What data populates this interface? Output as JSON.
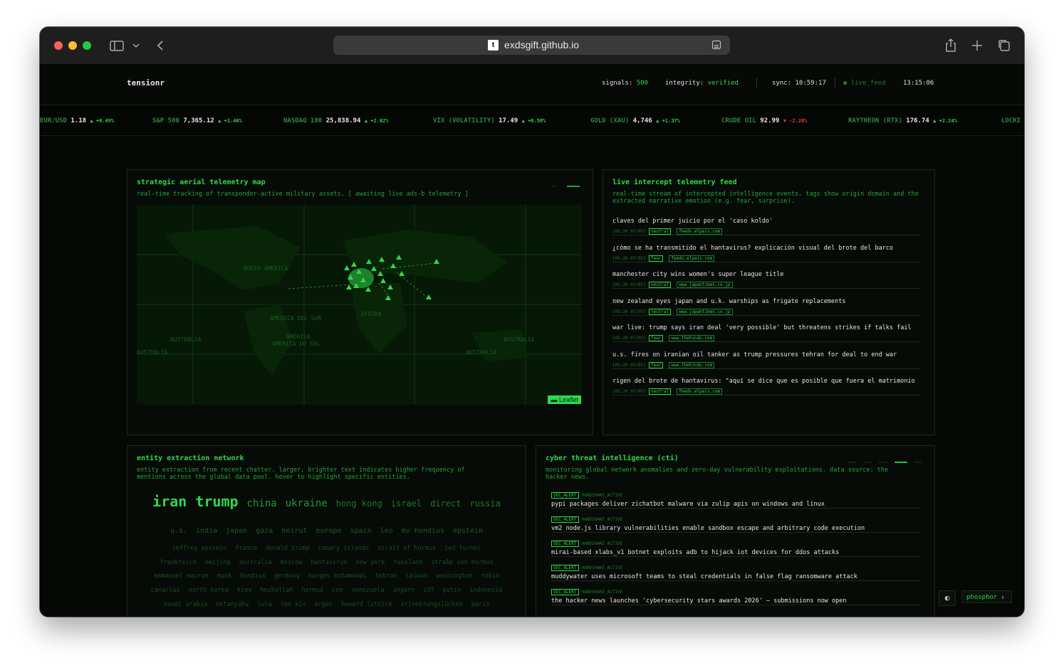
{
  "browser": {
    "url": "exdsgift.github.io",
    "favicon": "t"
  },
  "header": {
    "brand": "tensionr",
    "signals_label": "signals:",
    "signals_value": "500",
    "integrity_label": "integrity:",
    "integrity_value": "verified",
    "sync": "sync: 10:59:17",
    "live_feed": "live_feed",
    "clock": "13:15:06"
  },
  "ticker": [
    {
      "name": "EUR/USD",
      "price": "1.18",
      "change": "+0.49%",
      "dir": "up"
    },
    {
      "name": "S&P 500",
      "price": "7,365.12",
      "change": "+1.46%",
      "dir": "up"
    },
    {
      "name": "NASDAQ 100",
      "price": "25,838.94",
      "change": "+2.02%",
      "dir": "up"
    },
    {
      "name": "VIX (VOLATILITY)",
      "price": "17.49",
      "change": "+0.58%",
      "dir": "up"
    },
    {
      "name": "GOLD (XAU)",
      "price": "4,746",
      "change": "+1.37%",
      "dir": "up"
    },
    {
      "name": "CRUDE OIL",
      "price": "92.99",
      "change": "-2.20%",
      "dir": "down"
    },
    {
      "name": "RAYTHEON (RTX)",
      "price": "176.74",
      "change": "+2.24%",
      "dir": "up"
    },
    {
      "name": "LOCKI",
      "price": "",
      "change": "",
      "dir": "up"
    }
  ],
  "map_panel": {
    "title": "strategic aerial telemetry map",
    "desc": "real-time tracking of transponder-active military assets. [ awaiting live ads-b telemetry ]",
    "labels": [
      "NORTH AMERICA",
      "AFRIKA",
      "AMÉRICA",
      "AMERICA DO SUL",
      "AMÉRICA DEL SUR",
      "AUSTRALIA",
      "AUSTRALIA",
      "AUSTRALIA",
      "AUSTRALIA"
    ],
    "leaflet": "Leaflet"
  },
  "feed_panel": {
    "title": "live intercept telemetry feed",
    "desc": "real-time stream of intercepted intelligence events. tags show origin domain and the extracted narrative emotion (e.g. fear, surprise).",
    "items": [
      {
        "title": "claves del primer juicio por el 'caso koldo'",
        "time": "[05:20 07/05]",
        "emotion": "neutral",
        "domain": "feeds.elpais.com"
      },
      {
        "title": "¿cómo se ha transmitido el hantavirus? explicación visual del brote del barco",
        "time": "[05:20 07/05]",
        "emotion": "fear",
        "domain": "feeds.elpais.com"
      },
      {
        "title": "manchester city wins women's super league title",
        "time": "[05:20 07/05]",
        "emotion": "neutral",
        "domain": "www.japantimes.co.jp"
      },
      {
        "title": "new zealand eyes japan and u.k. warships as frigate replacements",
        "time": "[05:20 07/05]",
        "emotion": "neutral",
        "domain": "www.japantimes.co.jp"
      },
      {
        "title": " war live: trump says iran deal 'very possible' but threatens strikes if talks fail",
        "time": "[05:20 07/05]",
        "emotion": "fear",
        "domain": "www.thehindu.com"
      },
      {
        "title": "u.s. fires on iranian oil tanker as trump pressures tehran for deal to end war",
        "time": "[05:20 07/05]",
        "emotion": "fear",
        "domain": "www.thehindu.com"
      },
      {
        "title": "rigen del brote de hantavirus: \"aquí se dice que es posible que fuera el matrimonio",
        "time": "[05:20 07/05]",
        "emotion": "neutral",
        "domain": "feeds.elpais.com"
      }
    ]
  },
  "entity_panel": {
    "title": "entity extraction network",
    "desc": "entity extraction from recent chatter. larger, brighter text indicates higher frequency of mentions across the global data pool. hover to highlight specific entities.",
    "rows": [
      [
        "iran",
        "trump",
        "china",
        "ukraine",
        "hong kong",
        "israel",
        "direct",
        "russia"
      ],
      [
        "u.s.",
        "india",
        "japan",
        "gaza",
        "beirut",
        "europe",
        "spain",
        "leo",
        "mv hondius",
        "epstein"
      ],
      [
        "jeffrey epstein",
        "france",
        "donald trump",
        "canary islands",
        "strait of hormuz",
        "ted turner"
      ],
      [
        "frankreich",
        "beijing",
        "australia",
        "moscow",
        "hantavirus",
        "new york",
        "russland",
        "straße von hormus"
      ],
      [
        "emmanuel macron",
        "musk",
        "hondius",
        "germany",
        "narges mohammadi",
        "tehran",
        "taiwan",
        "washington",
        "rubio"
      ],
      [
        "canarias",
        "north korea",
        "kiev",
        "hezbollah",
        "hormuz",
        "cnn",
        "venezuela",
        "ungarn",
        "idf",
        "putin",
        "indonesia"
      ],
      [
        "saudi arabia",
        "netanyahu",
        "lula",
        "leo xiv",
        "ärger",
        "howard lutnick",
        "erinnerungslücken",
        "paris"
      ]
    ]
  },
  "cti_panel": {
    "title": "cyber threat intelligence (cti)",
    "desc": "monitoring global network anomalies and zero-day vulnerability exploitations. data source: the hacker news.",
    "items": [
      {
        "tag": "SEC_ALERT",
        "status": "HANDSHAKE_ACTIVE",
        "title": "pypi packages deliver zichatbot malware via zulip apis on windows and linux"
      },
      {
        "tag": "SEC_ALERT",
        "status": "HANDSHAKE_ACTIVE",
        "title": "vm2 node.js library vulnerabilities enable sandbox escape and arbitrary code execution"
      },
      {
        "tag": "SEC_ALERT",
        "status": "HANDSHAKE_ACTIVE",
        "title": "mirai-based xlabs_v1 botnet exploits adb to hijack iot devices for ddos attacks"
      },
      {
        "tag": "SEC_ALERT",
        "status": "HANDSHAKE_ACTIVE",
        "title": "muddywater uses microsoft teams to steal credentials in false flag ransomware attack"
      },
      {
        "tag": "SEC_ALERT",
        "status": "HANDSHAKE_ACTIVE",
        "title": "the hacker news launches 'cybersecurity stars awards 2026' — submissions now open"
      }
    ]
  },
  "controls": {
    "theme_icon": "contrast-icon",
    "theme_select": "phosphor"
  }
}
